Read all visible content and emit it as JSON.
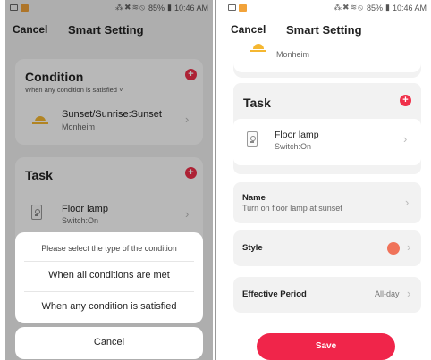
{
  "status": {
    "time": "10:46 AM",
    "battery": "85%",
    "icons": "⁂✖≋⦸"
  },
  "header": {
    "cancel": "Cancel",
    "title": "Smart Setting"
  },
  "condition": {
    "title": "Condition",
    "mode": "When any condition is satisfied",
    "mode_caret": "˅",
    "item": {
      "title": "Sunset/Sunrise:Sunset",
      "location": "Monheim"
    }
  },
  "task": {
    "title": "Task",
    "item": {
      "title": "Floor lamp",
      "state": "Switch:On"
    }
  },
  "sheet": {
    "prompt": "Please select the type of the condition",
    "option_all": "When all conditions are met",
    "option_any": "When any condition is satisfied",
    "cancel": "Cancel"
  },
  "settings": {
    "name_label": "Name",
    "name_value": "Turn on floor lamp at sunset",
    "style_label": "Style",
    "style_color": "#f0735a",
    "period_label": "Effective Period",
    "period_value": "All-day"
  },
  "save_button": "Save",
  "plus_glyph": "+",
  "chevron_glyph": "›",
  "colors": {
    "accent": "#f0254a",
    "card_bg": "#ffffff",
    "panel_bg": "#f2f2f2"
  }
}
